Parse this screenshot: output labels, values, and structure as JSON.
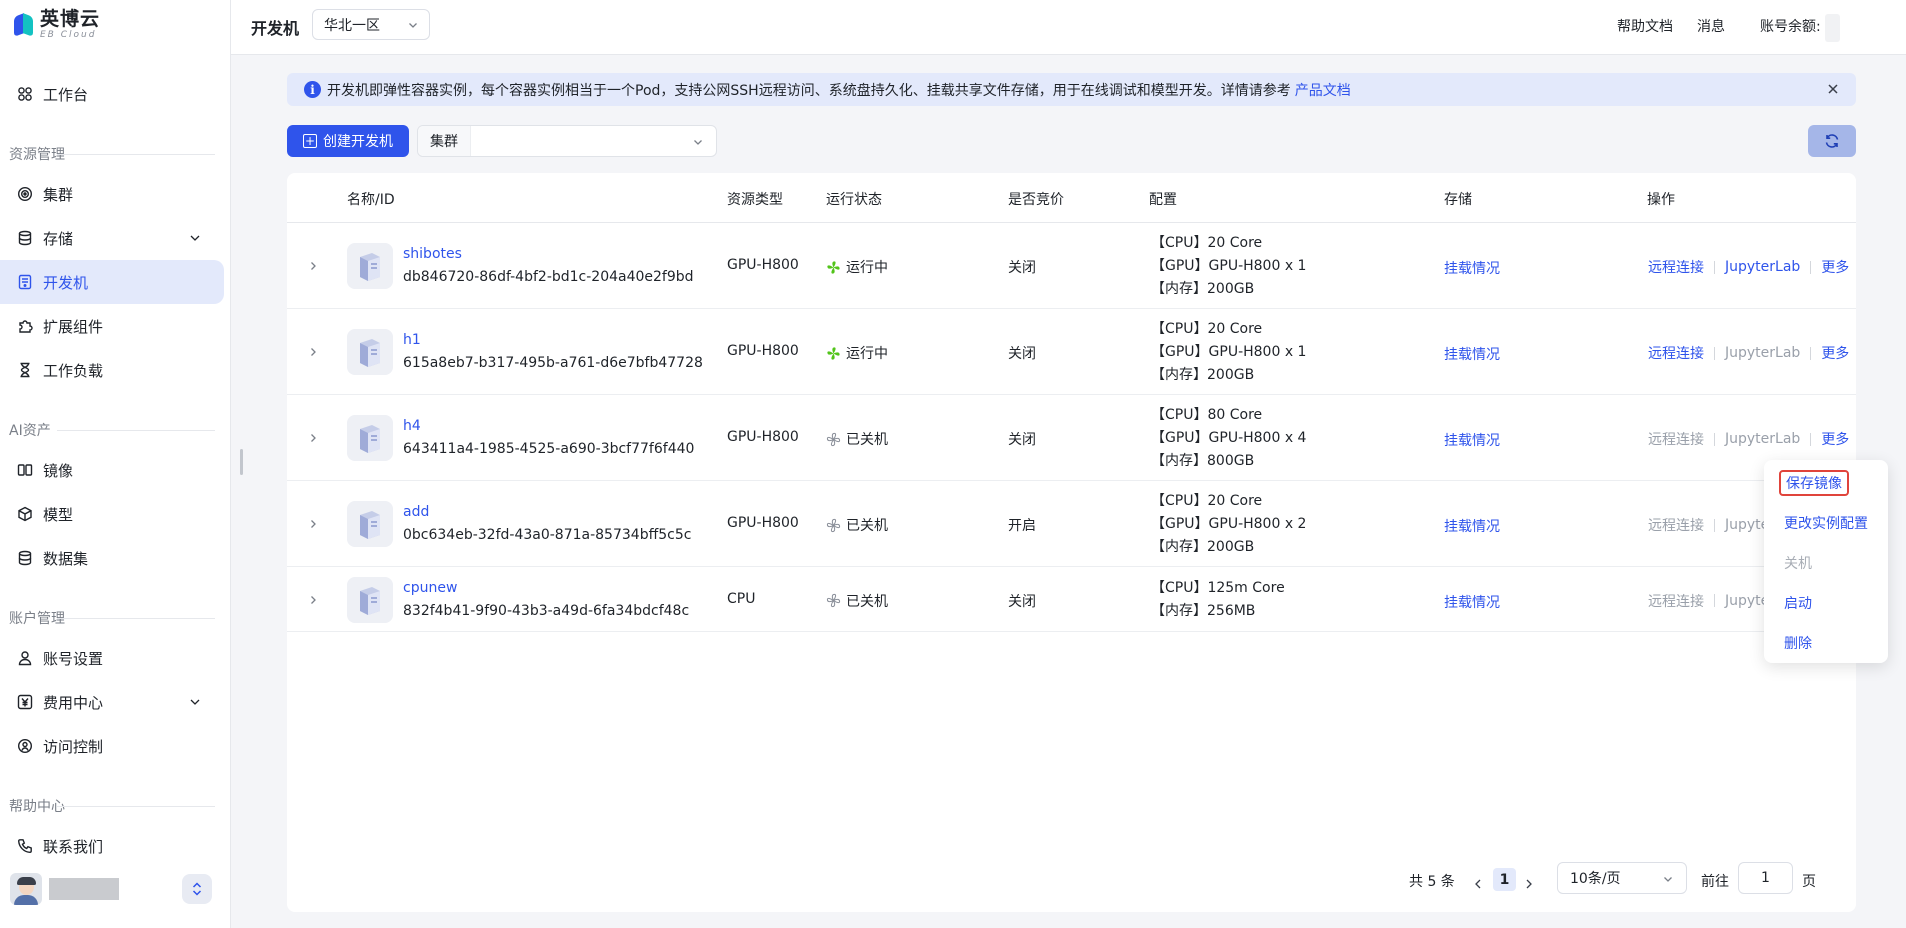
{
  "logo": {
    "name": "英博云",
    "sub": "EB Cloud"
  },
  "sidebar": {
    "workbench": "工作台",
    "groups": {
      "resource": "资源管理",
      "ai_assets": "AI资产",
      "account": "账户管理",
      "help": "帮助中心"
    },
    "items": {
      "cluster": "集群",
      "storage": "存储",
      "devmachine": "开发机",
      "extensions": "扩展组件",
      "workload": "工作负载",
      "image": "镜像",
      "model": "模型",
      "dataset": "数据集",
      "account_settings": "账号设置",
      "billing": "费用中心",
      "access_control": "访问控制",
      "contact": "联系我们"
    },
    "active": "devmachine"
  },
  "header": {
    "title": "开发机",
    "region": "华北一区",
    "help_docs": "帮助文档",
    "messages": "消息",
    "balance_label": "账号余额:"
  },
  "banner": {
    "text": "开发机即弹性容器实例，每个容器实例相当于一个Pod，支持公网SSH远程访问、系统盘持久化、挂载共享文件存储，用于在线调试和模型开发。详情请参考",
    "link": "产品文档"
  },
  "toolbar": {
    "create_label": "创建开发机",
    "cluster_label": "集群",
    "cluster_value": ""
  },
  "table": {
    "headers": {
      "name": "名称/ID",
      "resource_type": "资源类型",
      "status": "运行状态",
      "spot": "是否竞价",
      "config": "配置",
      "storage": "存储",
      "actions": "操作"
    },
    "rows": [
      {
        "name": "shibotes",
        "id": "db846720-86df-4bf2-bd1c-204a40e2f9bd",
        "resource_type": "GPU-H800",
        "status": "运行中",
        "status_color": "#52c41a",
        "spot": "关闭",
        "config": [
          "【CPU】20 Core",
          "【GPU】GPU-H800 x 1",
          "【内存】200GB"
        ],
        "storage": "挂载情况",
        "ops": {
          "remote": "远程连接",
          "jupyter": "JupyterLab",
          "more": "更多",
          "remote_enabled": true,
          "jupyter_enabled": true
        }
      },
      {
        "name": "h1",
        "id": "615a8eb7-b317-495b-a761-d6e7bfb47728",
        "resource_type": "GPU-H800",
        "status": "运行中",
        "status_color": "#52c41a",
        "spot": "关闭",
        "config": [
          "【CPU】20 Core",
          "【GPU】GPU-H800 x 1",
          "【内存】200GB"
        ],
        "storage": "挂载情况",
        "ops": {
          "remote": "远程连接",
          "jupyter": "JupyterLab",
          "more": "更多",
          "remote_enabled": true,
          "jupyter_enabled": false
        }
      },
      {
        "name": "h4",
        "id": "643411a4-1985-4525-a690-3bcf77f6f440",
        "resource_type": "GPU-H800",
        "status": "已关机",
        "status_color": "#8a8f99",
        "spot": "关闭",
        "config": [
          "【CPU】80 Core",
          "【GPU】GPU-H800 x 4",
          "【内存】800GB"
        ],
        "storage": "挂载情况",
        "ops": {
          "remote": "远程连接",
          "jupyter": "JupyterLab",
          "more": "更多",
          "remote_enabled": false,
          "jupyter_enabled": false
        }
      },
      {
        "name": "add",
        "id": "0bc634eb-32fd-43a0-871a-85734bff5c5c",
        "resource_type": "GPU-H800",
        "status": "已关机",
        "status_color": "#8a8f99",
        "spot": "开启",
        "config": [
          "【CPU】20 Core",
          "【GPU】GPU-H800 x 2",
          "【内存】200GB"
        ],
        "storage": "挂载情况",
        "ops": {
          "remote": "远程连接",
          "jupyter": "Jupyte",
          "more": "",
          "remote_enabled": false,
          "jupyter_enabled": false
        }
      },
      {
        "name": "cpunew",
        "id": "832f4b41-9f90-43b3-a49d-6fa34bdcf48c",
        "resource_type": "CPU",
        "status": "已关机",
        "status_color": "#8a8f99",
        "spot": "关闭",
        "config": [
          "【CPU】125m Core",
          "【内存】256MB"
        ],
        "storage": "挂载情况",
        "ops": {
          "remote": "远程连接",
          "jupyter": "Jupyte",
          "more": "",
          "remote_enabled": false,
          "jupyter_enabled": false
        }
      }
    ]
  },
  "more_menu": {
    "items": [
      {
        "label": "保存镜像",
        "enabled": true,
        "highlighted": true
      },
      {
        "label": "更改实例配置",
        "enabled": true
      },
      {
        "label": "关机",
        "enabled": false
      },
      {
        "label": "启动",
        "enabled": true
      },
      {
        "label": "删除",
        "enabled": true
      }
    ]
  },
  "pagination": {
    "total": "共 5 条",
    "current_page": "1",
    "page_size": "10条/页",
    "goto_label": "前往",
    "goto_value": "1",
    "page_suffix": "页"
  },
  "colors": {
    "primary": "#2f54eb",
    "active_bg": "#e3e9fb",
    "running": "#52c41a",
    "stopped": "#8a8f99",
    "highlight_border": "#e0443b"
  }
}
